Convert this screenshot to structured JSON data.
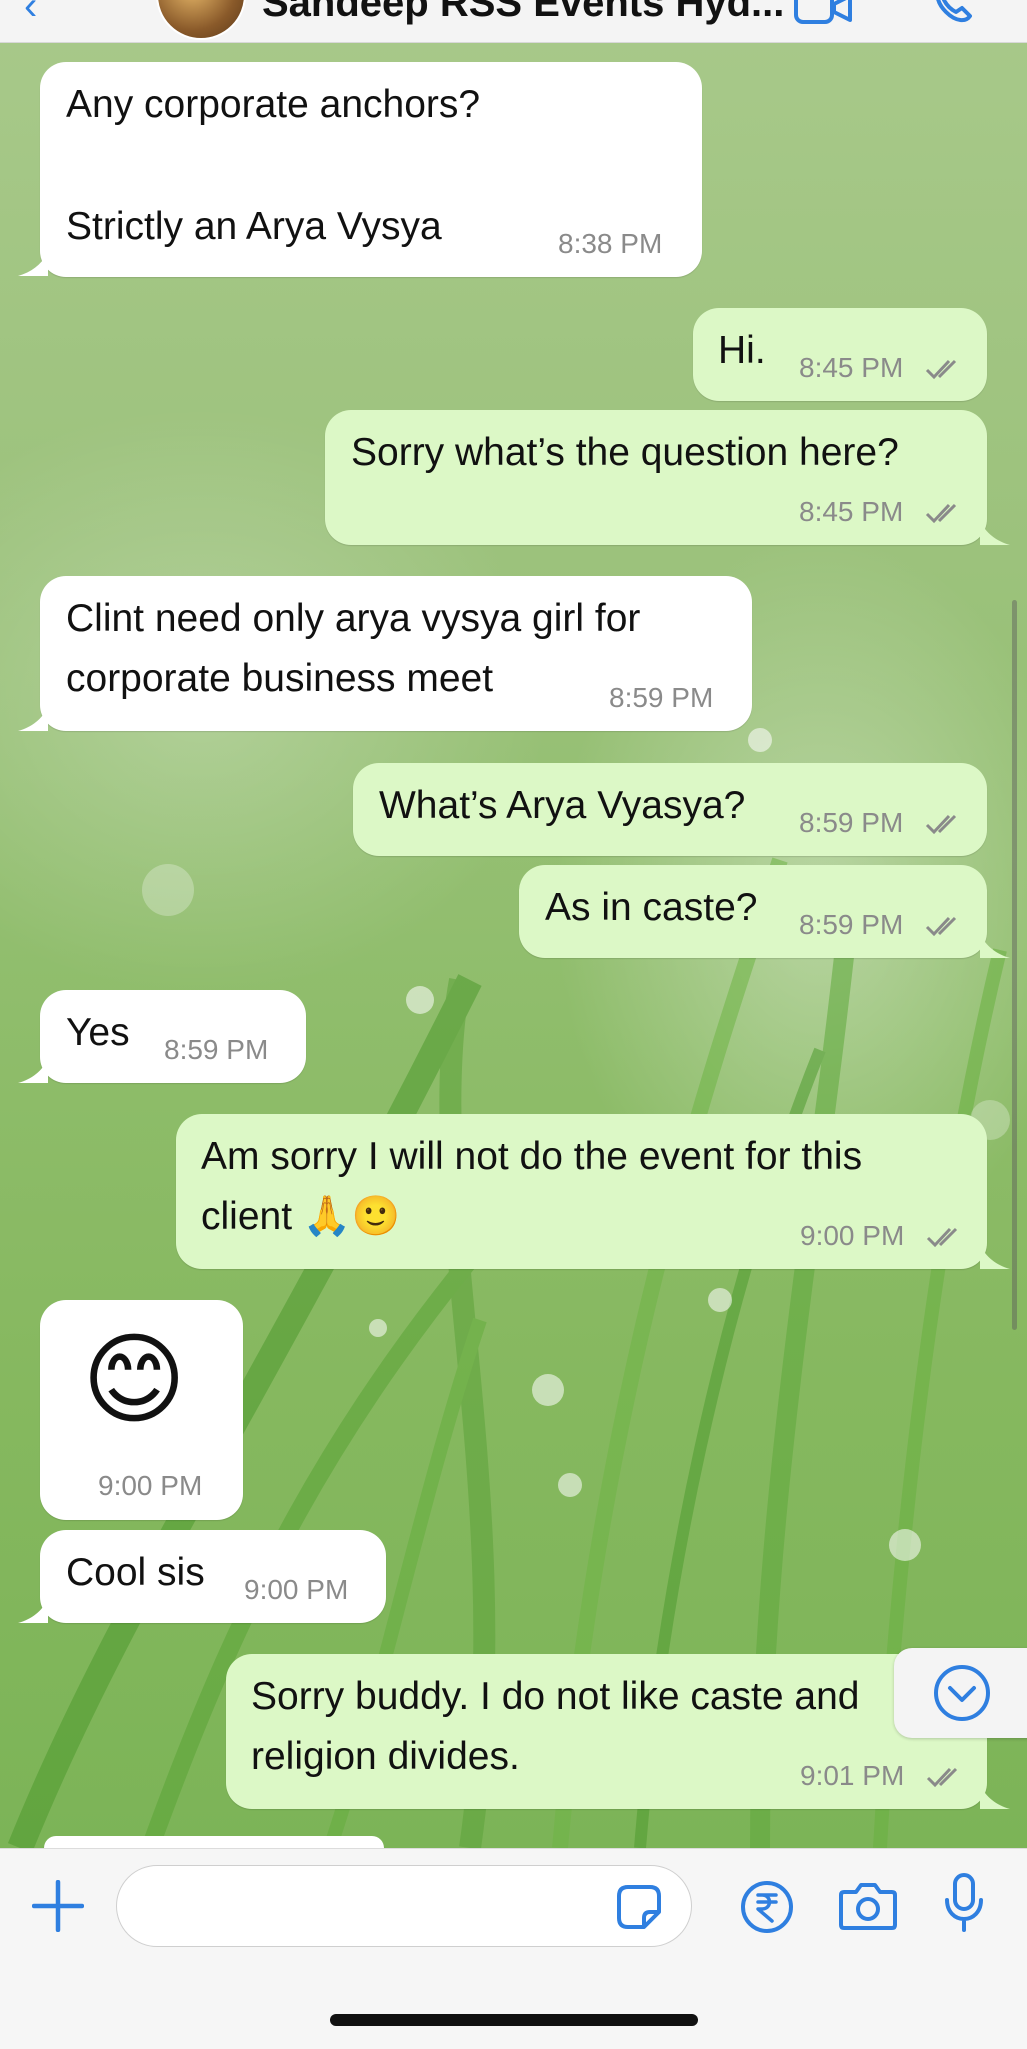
{
  "header": {
    "title": "Sandeep RSS Events Hyd...",
    "back_icon": "chevron-left-icon",
    "video_icon": "video-camera-icon",
    "call_icon": "phone-icon"
  },
  "messages": [
    {
      "dir": "in",
      "lines": [
        "Any corporate anchors?",
        "",
        "Strictly an Arya Vysya"
      ],
      "time": "8:38 PM"
    },
    {
      "dir": "out",
      "lines": [
        "Hi."
      ],
      "time": "8:45 PM",
      "status": "read"
    },
    {
      "dir": "out",
      "lines": [
        "Sorry what’s the question here?"
      ],
      "time": "8:45 PM",
      "status": "read"
    },
    {
      "dir": "in",
      "lines": [
        "Clint need only arya vysya girl for",
        "corporate business meet"
      ],
      "time": "8:59 PM"
    },
    {
      "dir": "out",
      "lines": [
        "What’s Arya Vyasya?"
      ],
      "time": "8:59 PM",
      "status": "read"
    },
    {
      "dir": "out",
      "lines": [
        "As in caste?"
      ],
      "time": "8:59 PM",
      "status": "read"
    },
    {
      "dir": "in",
      "lines": [
        "Yes"
      ],
      "time": "8:59 PM"
    },
    {
      "dir": "out",
      "lines": [
        "Am sorry I will not do the event for this",
        "client 🙏🙂"
      ],
      "time": "9:00 PM",
      "status": "read"
    },
    {
      "dir": "in",
      "lines": [
        "😊"
      ],
      "time": "9:00 PM",
      "emoji_only": true
    },
    {
      "dir": "in",
      "lines": [
        "Cool sis"
      ],
      "time": "9:00 PM"
    },
    {
      "dir": "out",
      "lines": [
        "Sorry buddy. I do not like caste and",
        "religion divides."
      ],
      "time": "9:01 PM",
      "status": "read"
    }
  ],
  "colors": {
    "incoming_bubble": "#ffffff",
    "outgoing_bubble": "#dcf8c6",
    "accent": "#2f7fe0",
    "timestamp": "#8a8a8a",
    "read_ticks": "#8a8a8a"
  },
  "composer": {
    "input_value": "",
    "plus_icon": "plus-icon",
    "sticker_icon": "sticker-icon",
    "payment_icon": "rupee-payment-icon",
    "camera_icon": "camera-icon",
    "mic_icon": "microphone-icon"
  },
  "scroll_down_icon": "chevron-down-circle-icon"
}
